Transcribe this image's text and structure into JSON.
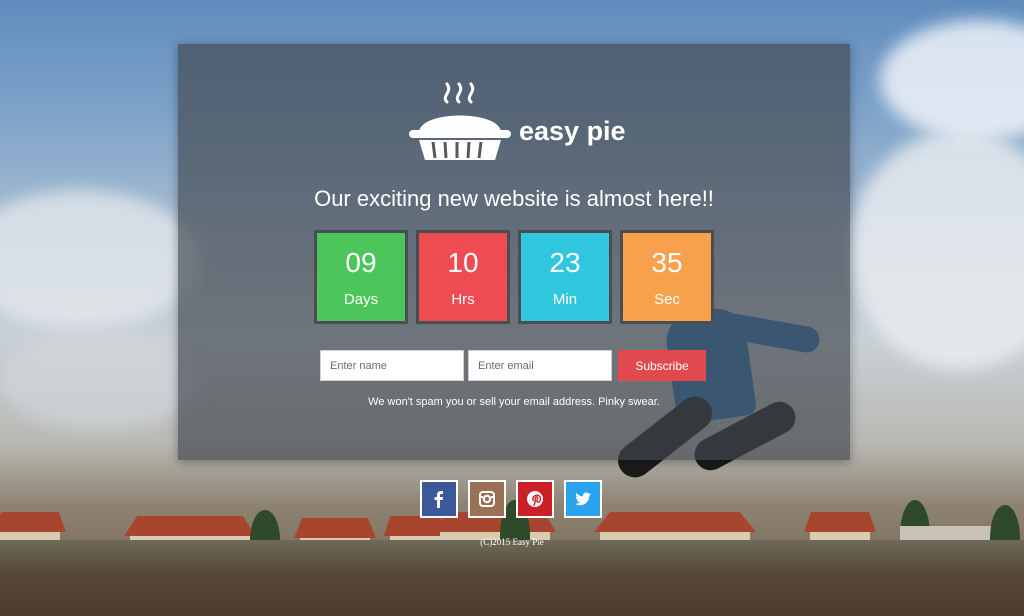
{
  "brand": {
    "name": "easy pie"
  },
  "headline": "Our exciting new website is almost here!!",
  "countdown": [
    {
      "value": "09",
      "label": "Days",
      "color": "#4cc55a"
    },
    {
      "value": "10",
      "label": "Hrs",
      "color": "#ef4b52"
    },
    {
      "value": "23",
      "label": "Min",
      "color": "#2fc6de"
    },
    {
      "value": "35",
      "label": "Sec",
      "color": "#f7a14d"
    }
  ],
  "form": {
    "name_placeholder": "Enter name",
    "email_placeholder": "Enter email",
    "subscribe_label": "Subscribe",
    "subscribe_color": "#e04a4f"
  },
  "note": "We won't spam you or sell your email address. Pinky swear.",
  "social": [
    {
      "icon": "facebook-icon",
      "color": "#3b5998"
    },
    {
      "icon": "instagram-icon",
      "color": "#9a7056"
    },
    {
      "icon": "pinterest-icon",
      "color": "#cb2027"
    },
    {
      "icon": "twitter-icon",
      "color": "#2aa3ef"
    }
  ],
  "footer": {
    "copyright": "(C)2015 Easy Pie"
  }
}
